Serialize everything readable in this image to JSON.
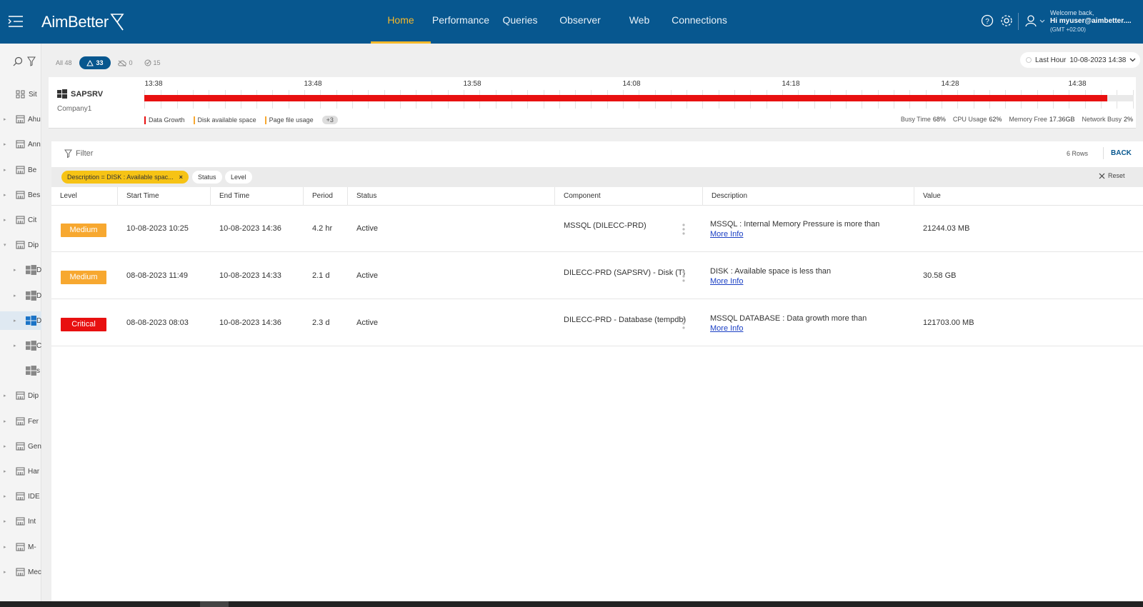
{
  "header": {
    "logo_text": "AimBetter",
    "nav": [
      {
        "label": "Home",
        "active": true
      },
      {
        "label": "Performance"
      },
      {
        "label": "Queries"
      },
      {
        "label": "Observer"
      },
      {
        "label": "Web"
      },
      {
        "label": "Connections"
      }
    ],
    "user": {
      "welcome": "Welcome back,",
      "name": "Hi myuser@aimbetter....",
      "timezone": "(GMT +02:00)"
    },
    "accent": "#f7b92b",
    "bar_color": "#07578f"
  },
  "sidebar": {
    "items": [
      {
        "label": "Sit",
        "icon": "grid-icon"
      },
      {
        "label": "Ahu",
        "icon": "building-icon"
      },
      {
        "label": "Ann",
        "icon": "building-icon"
      },
      {
        "label": "Be",
        "icon": "building-icon"
      },
      {
        "label": "Bes",
        "icon": "building-icon"
      },
      {
        "label": "Cit",
        "icon": "building-icon"
      },
      {
        "label": "Dip",
        "icon": "building-icon"
      },
      {
        "label": "D",
        "icon": "windows-icon"
      },
      {
        "label": "D",
        "icon": "windows-icon"
      },
      {
        "label": "D",
        "icon": "windows-icon"
      },
      {
        "label": "C",
        "icon": "windows-icon"
      },
      {
        "label": "s",
        "icon": "windows-icon"
      },
      {
        "label": "Dip",
        "icon": "building-icon"
      },
      {
        "label": "Fer",
        "icon": "building-icon"
      },
      {
        "label": "Gen",
        "icon": "building-icon"
      },
      {
        "label": "Har",
        "icon": "building-icon"
      },
      {
        "label": "IDE",
        "icon": "building-icon"
      },
      {
        "label": "Int",
        "icon": "building-icon"
      },
      {
        "label": "M-",
        "icon": "building-icon"
      },
      {
        "label": "Mec",
        "icon": "building-icon"
      }
    ]
  },
  "toolbar": {
    "all_label": "All 48",
    "alerts_count": "33",
    "offline_count": "0",
    "resolved_count": "15",
    "time_range": "Last Hour",
    "time_value": "10-08-2023 14:38"
  },
  "server": {
    "name": "SAPSRV",
    "company": "Company1",
    "ticks": [
      "13:38",
      "13:48",
      "13:58",
      "14:08",
      "14:18",
      "14:28",
      "14:38"
    ],
    "legend": [
      {
        "label": "Data Growth",
        "color": "#e81010"
      },
      {
        "label": "Disk available space",
        "color": "#f7a830"
      },
      {
        "label": "Page file usage",
        "color": "#f7a830"
      }
    ],
    "legend_more": "+3",
    "stats": [
      {
        "label": "Busy Time",
        "value": "68%"
      },
      {
        "label": "CPU Usage",
        "value": "62%"
      },
      {
        "label": "Memory Free",
        "value": "17.36GB"
      },
      {
        "label": "Network Busy",
        "value": "2%"
      }
    ]
  },
  "panel": {
    "filter_label": "Filter",
    "rows_count": "6 Rows",
    "back_label": "BACK",
    "reset_label": "Reset",
    "chips": {
      "active": "Description = DISK : Available spac...",
      "status": "Status",
      "level": "Level"
    },
    "columns": [
      "Level",
      "Start Time",
      "End Time",
      "Period",
      "Status",
      "Component",
      "Description",
      "Value"
    ],
    "more_info": "More Info",
    "rows": [
      {
        "level": "Medium",
        "start": "10-08-2023 10:25",
        "end": "10-08-2023 14:36",
        "period": "4.2 hr",
        "status": "Active",
        "component": "MSSQL (DILECC-PRD)",
        "description": "MSSQL : Internal Memory Pressure is more than",
        "value": "21244.03 MB"
      },
      {
        "level": "Medium",
        "start": "08-08-2023 11:49",
        "end": "10-08-2023 14:33",
        "period": "2.1 d",
        "status": "Active",
        "component": "DILECC-PRD (SAPSRV) - Disk (T)",
        "description": "DISK : Available space is less than",
        "value": "30.58 GB"
      },
      {
        "level": "Critical",
        "start": "08-08-2023 08:03",
        "end": "10-08-2023 14:36",
        "period": "2.3 d",
        "status": "Active",
        "component": "DILECC-PRD - Database (tempdb)",
        "description": "MSSQL DATABASE : Data growth more than",
        "value": "121703.00 MB"
      }
    ]
  }
}
